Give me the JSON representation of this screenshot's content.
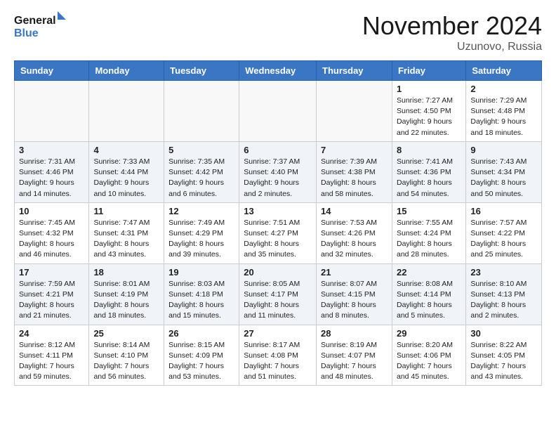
{
  "header": {
    "logo_line1": "General",
    "logo_line2": "Blue",
    "month": "November 2024",
    "location": "Uzunovo, Russia"
  },
  "weekdays": [
    "Sunday",
    "Monday",
    "Tuesday",
    "Wednesday",
    "Thursday",
    "Friday",
    "Saturday"
  ],
  "weeks": [
    [
      {
        "day": "",
        "info": ""
      },
      {
        "day": "",
        "info": ""
      },
      {
        "day": "",
        "info": ""
      },
      {
        "day": "",
        "info": ""
      },
      {
        "day": "",
        "info": ""
      },
      {
        "day": "1",
        "info": "Sunrise: 7:27 AM\nSunset: 4:50 PM\nDaylight: 9 hours\nand 22 minutes."
      },
      {
        "day": "2",
        "info": "Sunrise: 7:29 AM\nSunset: 4:48 PM\nDaylight: 9 hours\nand 18 minutes."
      }
    ],
    [
      {
        "day": "3",
        "info": "Sunrise: 7:31 AM\nSunset: 4:46 PM\nDaylight: 9 hours\nand 14 minutes."
      },
      {
        "day": "4",
        "info": "Sunrise: 7:33 AM\nSunset: 4:44 PM\nDaylight: 9 hours\nand 10 minutes."
      },
      {
        "day": "5",
        "info": "Sunrise: 7:35 AM\nSunset: 4:42 PM\nDaylight: 9 hours\nand 6 minutes."
      },
      {
        "day": "6",
        "info": "Sunrise: 7:37 AM\nSunset: 4:40 PM\nDaylight: 9 hours\nand 2 minutes."
      },
      {
        "day": "7",
        "info": "Sunrise: 7:39 AM\nSunset: 4:38 PM\nDaylight: 8 hours\nand 58 minutes."
      },
      {
        "day": "8",
        "info": "Sunrise: 7:41 AM\nSunset: 4:36 PM\nDaylight: 8 hours\nand 54 minutes."
      },
      {
        "day": "9",
        "info": "Sunrise: 7:43 AM\nSunset: 4:34 PM\nDaylight: 8 hours\nand 50 minutes."
      }
    ],
    [
      {
        "day": "10",
        "info": "Sunrise: 7:45 AM\nSunset: 4:32 PM\nDaylight: 8 hours\nand 46 minutes."
      },
      {
        "day": "11",
        "info": "Sunrise: 7:47 AM\nSunset: 4:31 PM\nDaylight: 8 hours\nand 43 minutes."
      },
      {
        "day": "12",
        "info": "Sunrise: 7:49 AM\nSunset: 4:29 PM\nDaylight: 8 hours\nand 39 minutes."
      },
      {
        "day": "13",
        "info": "Sunrise: 7:51 AM\nSunset: 4:27 PM\nDaylight: 8 hours\nand 35 minutes."
      },
      {
        "day": "14",
        "info": "Sunrise: 7:53 AM\nSunset: 4:26 PM\nDaylight: 8 hours\nand 32 minutes."
      },
      {
        "day": "15",
        "info": "Sunrise: 7:55 AM\nSunset: 4:24 PM\nDaylight: 8 hours\nand 28 minutes."
      },
      {
        "day": "16",
        "info": "Sunrise: 7:57 AM\nSunset: 4:22 PM\nDaylight: 8 hours\nand 25 minutes."
      }
    ],
    [
      {
        "day": "17",
        "info": "Sunrise: 7:59 AM\nSunset: 4:21 PM\nDaylight: 8 hours\nand 21 minutes."
      },
      {
        "day": "18",
        "info": "Sunrise: 8:01 AM\nSunset: 4:19 PM\nDaylight: 8 hours\nand 18 minutes."
      },
      {
        "day": "19",
        "info": "Sunrise: 8:03 AM\nSunset: 4:18 PM\nDaylight: 8 hours\nand 15 minutes."
      },
      {
        "day": "20",
        "info": "Sunrise: 8:05 AM\nSunset: 4:17 PM\nDaylight: 8 hours\nand 11 minutes."
      },
      {
        "day": "21",
        "info": "Sunrise: 8:07 AM\nSunset: 4:15 PM\nDaylight: 8 hours\nand 8 minutes."
      },
      {
        "day": "22",
        "info": "Sunrise: 8:08 AM\nSunset: 4:14 PM\nDaylight: 8 hours\nand 5 minutes."
      },
      {
        "day": "23",
        "info": "Sunrise: 8:10 AM\nSunset: 4:13 PM\nDaylight: 8 hours\nand 2 minutes."
      }
    ],
    [
      {
        "day": "24",
        "info": "Sunrise: 8:12 AM\nSunset: 4:11 PM\nDaylight: 7 hours\nand 59 minutes."
      },
      {
        "day": "25",
        "info": "Sunrise: 8:14 AM\nSunset: 4:10 PM\nDaylight: 7 hours\nand 56 minutes."
      },
      {
        "day": "26",
        "info": "Sunrise: 8:15 AM\nSunset: 4:09 PM\nDaylight: 7 hours\nand 53 minutes."
      },
      {
        "day": "27",
        "info": "Sunrise: 8:17 AM\nSunset: 4:08 PM\nDaylight: 7 hours\nand 51 minutes."
      },
      {
        "day": "28",
        "info": "Sunrise: 8:19 AM\nSunset: 4:07 PM\nDaylight: 7 hours\nand 48 minutes."
      },
      {
        "day": "29",
        "info": "Sunrise: 8:20 AM\nSunset: 4:06 PM\nDaylight: 7 hours\nand 45 minutes."
      },
      {
        "day": "30",
        "info": "Sunrise: 8:22 AM\nSunset: 4:05 PM\nDaylight: 7 hours\nand 43 minutes."
      }
    ]
  ]
}
